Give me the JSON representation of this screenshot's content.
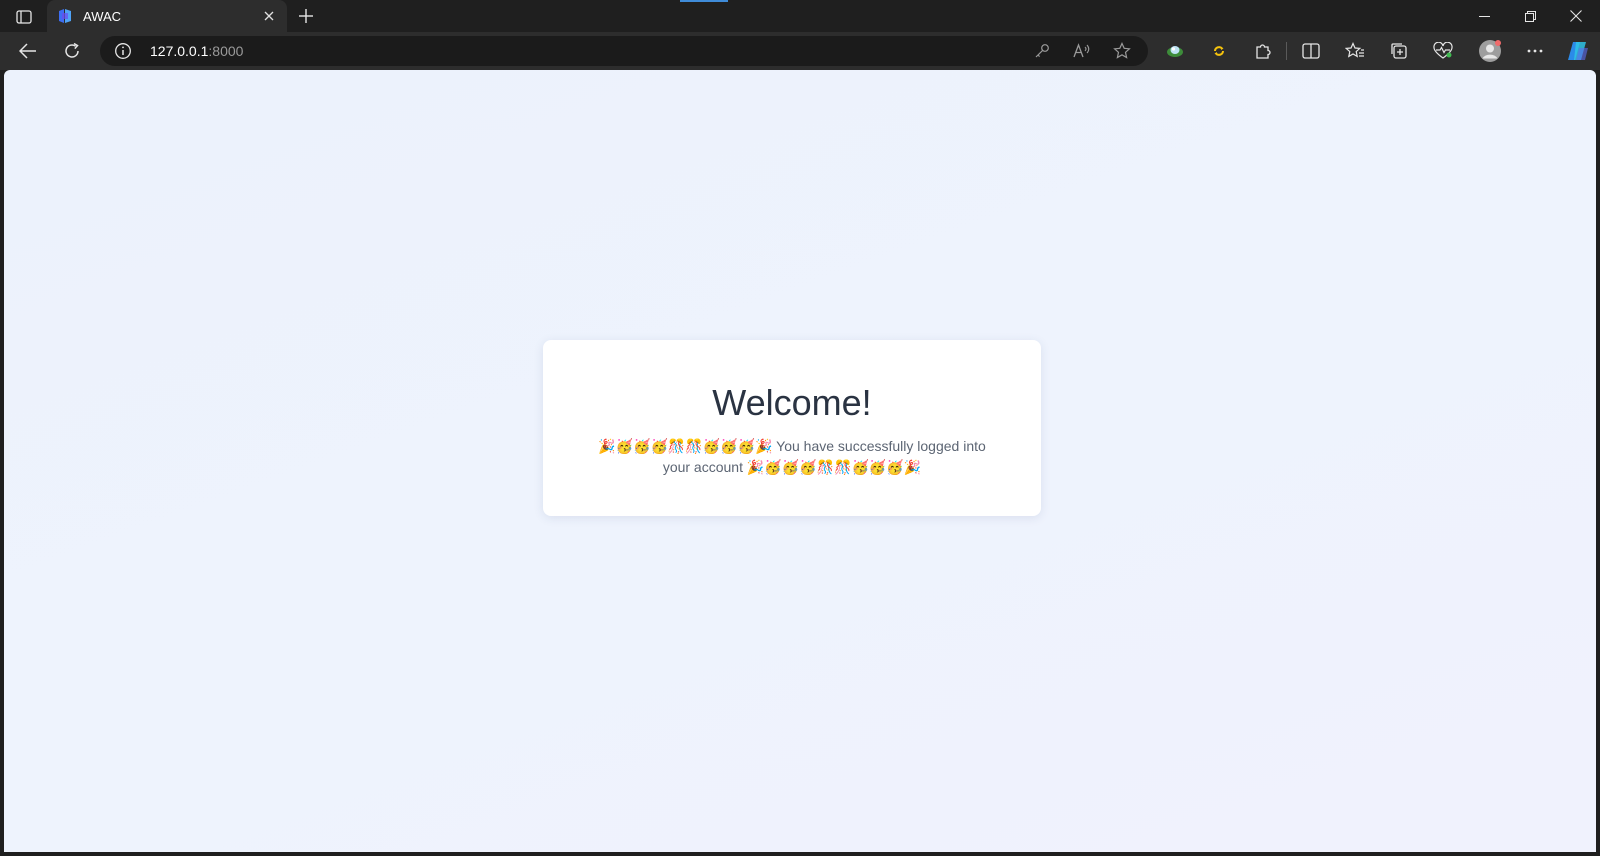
{
  "browser": {
    "tab": {
      "title": "AWAC"
    },
    "address": {
      "host": "127.0.0.1",
      "port": ":8000"
    },
    "icons": {
      "tab_actions": "tab-actions-icon",
      "favicon": "awac-logo-icon",
      "close_tab": "close-icon",
      "new_tab": "plus-icon",
      "back": "back-arrow-icon",
      "refresh": "refresh-icon",
      "site_info": "info-icon",
      "password": "key-icon",
      "read_aloud": "read-aloud-icon",
      "favorite": "star-icon",
      "extensions": "puzzle-icon",
      "split_screen": "split-screen-icon",
      "favorites": "favorites-icon",
      "collections": "collections-icon",
      "browser_essentials": "heart-pulse-icon",
      "profile": "avatar-icon",
      "more": "ellipsis-icon",
      "copilot": "copilot-icon"
    },
    "colors": {
      "chrome": "#1f1f1f",
      "toolbar": "#2d2d2d",
      "page_bg": "#eef3fd"
    }
  },
  "page": {
    "heading": "Welcome!",
    "message": "🎉🥳🥳🥳🎊🎊🥳🥳🥳🎉 You have successfully logged into your account 🎉🥳🥳🥳🎊🎊🥳🥳🥳🎉"
  }
}
